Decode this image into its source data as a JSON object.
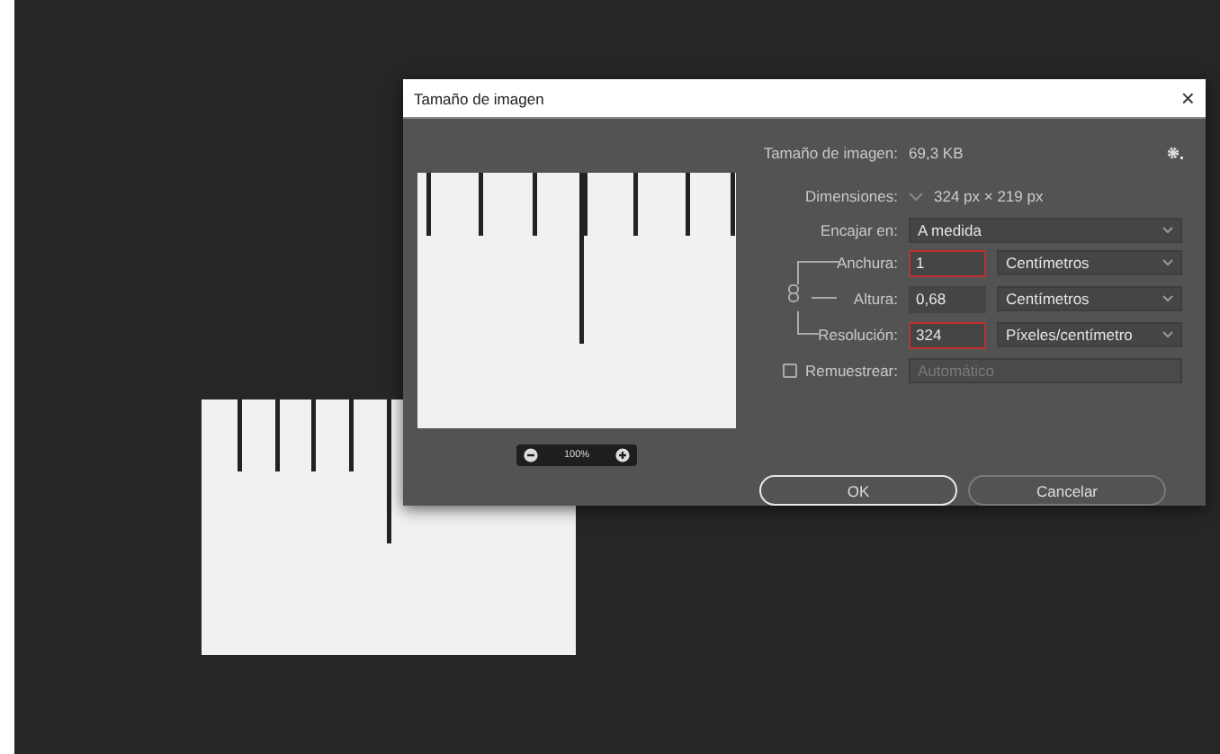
{
  "dialog": {
    "title": "Tamaño de imagen",
    "close": "×",
    "image_size": {
      "label": "Tamaño de imagen:",
      "value": "69,3 KB"
    },
    "dimensions": {
      "label": "Dimensiones:",
      "value": "324 px × 219 px"
    },
    "fit_to": {
      "label": "Encajar en:",
      "value": "A medida"
    },
    "fields": [
      {
        "label": "Anchura:",
        "value": "1",
        "highlighted": true,
        "unit": "Centímetros"
      },
      {
        "label": "Altura:",
        "value": "0,68",
        "highlighted": false,
        "unit": "Centímetros"
      },
      {
        "label": "Resolución:",
        "value": "324",
        "highlighted": true,
        "unit": "Píxeles/centímetro"
      }
    ],
    "resample": {
      "label": "Remuestrear:",
      "checked": false,
      "value": "Automático",
      "disabled": true
    },
    "zoom": "100%",
    "buttons": [
      {
        "label": "OK",
        "focused": true
      },
      {
        "label": "Cancelar",
        "focused": false
      }
    ]
  }
}
